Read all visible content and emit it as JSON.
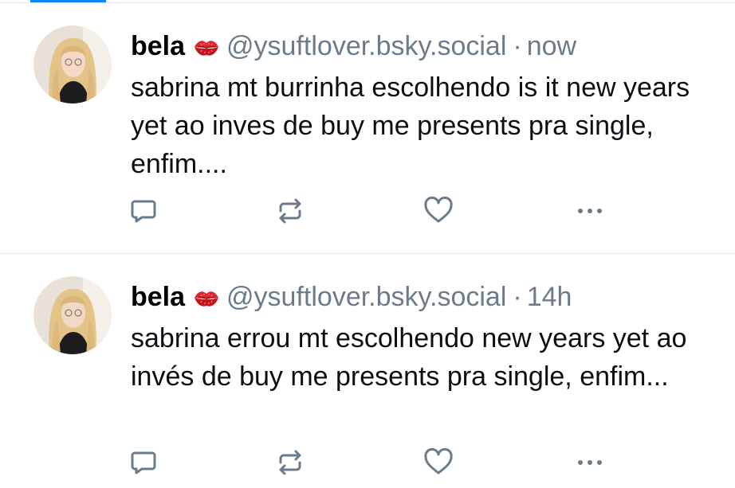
{
  "colors": {
    "accent": "#1083fe",
    "icon": "#6a7b8c",
    "text": "#0b0f14",
    "divider": "#e6e9ed"
  },
  "posts": [
    {
      "display_name": "bela",
      "emoji": "kiss-mark-icon",
      "handle": "@ysuftlover.bsky.social",
      "separator": "·",
      "time": "now",
      "text": "sabrina mt burrinha escolhendo is it new years yet ao inves de buy me presents pra single, enfim...."
    },
    {
      "display_name": "bela",
      "emoji": "kiss-mark-icon",
      "handle": "@ysuftlover.bsky.social",
      "separator": "·",
      "time": "14h",
      "text": "sabrina errou mt escolhendo new years yet ao invés de buy me presents pra single, enfim..."
    }
  ],
  "actions": [
    "reply-icon",
    "repost-icon",
    "like-icon",
    "more-icon"
  ]
}
